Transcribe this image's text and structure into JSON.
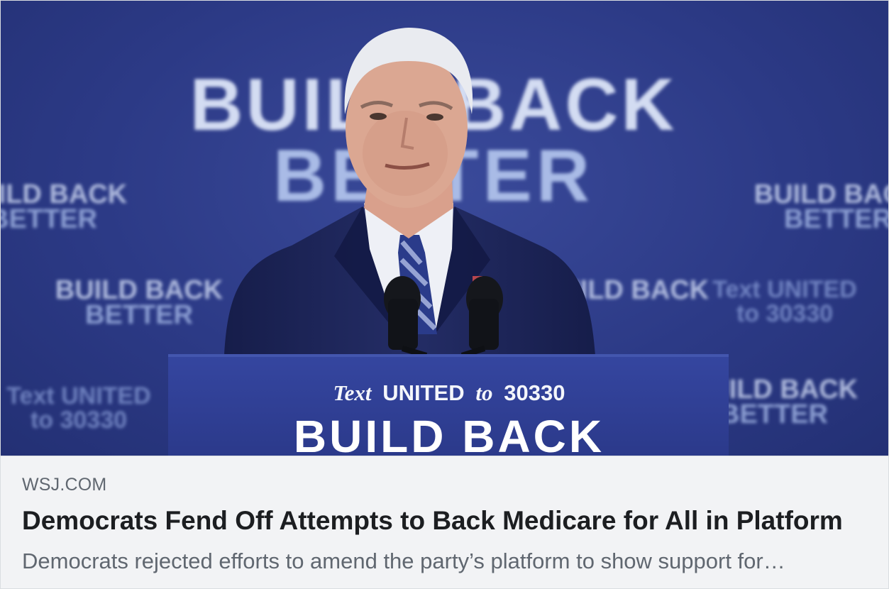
{
  "link_preview": {
    "image": {
      "backdrop_line1": "BUILD BACK",
      "backdrop_line2": "BETTER",
      "small_repeat_line1": "BUILD BACK",
      "small_repeat_line2": "BETTER",
      "small_text_line1": "Text UNITED",
      "small_text_line2": "to 30330",
      "podium_line1_prefix": "Text",
      "podium_line1_main": "UNITED",
      "podium_line1_to": "to",
      "podium_line1_number": "30330",
      "podium_line2": "BUILD BACK"
    },
    "domain": "WSJ.COM",
    "headline": "Democrats Fend Off Attempts to Back Medicare for All in Platform",
    "description": "Democrats rejected efforts to amend the party’s platform to show support for…"
  },
  "colors": {
    "backdrop": "#2c3a86",
    "backdrop_text": "#c9d4ee",
    "podium": "#2b3987",
    "suit": "#1d2558",
    "caption_bg": "#f2f3f5",
    "domain_text": "#606770",
    "headline_text": "#1c1e21"
  }
}
